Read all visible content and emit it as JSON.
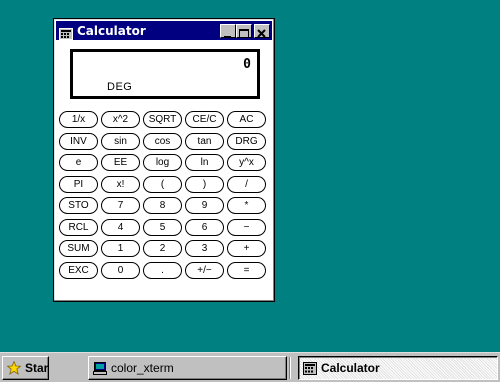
{
  "window": {
    "title": "Calculator",
    "title_icon": "calculator-icon",
    "controls": [
      "minimize-icon",
      "maximize-icon",
      "close-icon"
    ]
  },
  "display": {
    "value": "0",
    "mode": "DEG"
  },
  "keys": [
    [
      "1/x",
      "x^2",
      "SQRT",
      "CE/C",
      "AC"
    ],
    [
      "INV",
      "sin",
      "cos",
      "tan",
      "DRG"
    ],
    [
      "e",
      "EE",
      "log",
      "ln",
      "y^x"
    ],
    [
      "PI",
      "x!",
      "(",
      ")",
      "/"
    ],
    [
      "STO",
      "7",
      "8",
      "9",
      "*"
    ],
    [
      "RCL",
      "4",
      "5",
      "6",
      "−"
    ],
    [
      "SUM",
      "1",
      "2",
      "3",
      "+"
    ],
    [
      "EXC",
      "0",
      ".",
      "+/−",
      "="
    ]
  ],
  "taskbar": {
    "start_label": "Start",
    "tasks": [
      {
        "label": "color_xterm",
        "icon": "terminal-icon",
        "active": false
      },
      {
        "label": "Calculator",
        "icon": "calculator-icon",
        "active": true
      }
    ]
  },
  "colors": {
    "desktop": "#008080",
    "titlebar": "#000080",
    "taskbar": "#c0c0c0"
  }
}
